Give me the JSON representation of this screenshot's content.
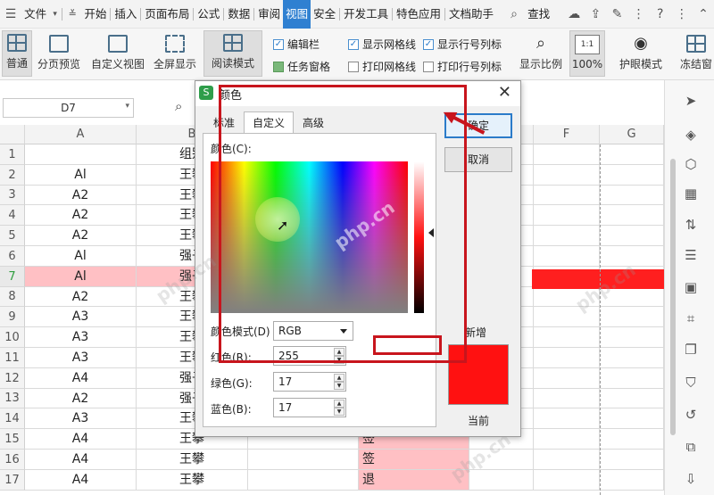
{
  "menubar": {
    "file": "文件",
    "items": [
      "开始",
      "插入",
      "页面布局",
      "公式",
      "数据",
      "审阅",
      "视图",
      "安全",
      "开发工具",
      "特色应用",
      "文档助手"
    ],
    "active_index": 6,
    "search": "查找"
  },
  "ribbon": {
    "normal": "普通",
    "page_break": "分页预览",
    "custom_view": "自定义视图",
    "fullscreen": "全屏显示",
    "reading_mode": "阅读模式",
    "edit_bar": "编辑栏",
    "task_pane": "任务窗格",
    "show_grid": "显示网格线",
    "print_grid": "打印网格线",
    "show_headers": "显示行号列标",
    "print_headers": "打印行号列标",
    "zoom_ratio": "显示比例",
    "zoom_100": "100%",
    "zoom_box": "1:1",
    "eye_mode": "护眼模式",
    "freeze": "冻结窗"
  },
  "formula": {
    "namebox": "D7"
  },
  "sheet": {
    "columns": [
      "A",
      "B",
      "F",
      "G"
    ],
    "rows": [
      {
        "n": "1",
        "a": "",
        "b": "组别",
        "d": ""
      },
      {
        "n": "2",
        "a": "Al",
        "b": "王攀",
        "d": ""
      },
      {
        "n": "3",
        "a": "A2",
        "b": "王攀",
        "d": ""
      },
      {
        "n": "4",
        "a": "A2",
        "b": "王攀",
        "d": ""
      },
      {
        "n": "5",
        "a": "A2",
        "b": "王攀",
        "d": ""
      },
      {
        "n": "6",
        "a": "Al",
        "b": "强子",
        "d": ""
      },
      {
        "n": "7",
        "a": "Al",
        "b": "强子",
        "d": ""
      },
      {
        "n": "8",
        "a": "A2",
        "b": "王攀",
        "d": ""
      },
      {
        "n": "9",
        "a": "A3",
        "b": "王攀",
        "d": ""
      },
      {
        "n": "10",
        "a": "A3",
        "b": "王攀",
        "d": ""
      },
      {
        "n": "11",
        "a": "A3",
        "b": "王攀",
        "d": ""
      },
      {
        "n": "12",
        "a": "A4",
        "b": "强子",
        "d": ""
      },
      {
        "n": "13",
        "a": "A2",
        "b": "强子",
        "d": ""
      },
      {
        "n": "14",
        "a": "A3",
        "b": "王攀",
        "d": ""
      },
      {
        "n": "15",
        "a": "A4",
        "b": "王攀",
        "d": "签"
      },
      {
        "n": "16",
        "a": "A4",
        "b": "王攀",
        "d": "签"
      },
      {
        "n": "17",
        "a": "A4",
        "b": "王攀",
        "d": "退"
      }
    ]
  },
  "dialog": {
    "title": "颜色",
    "tabs": [
      "标准",
      "自定义",
      "高级"
    ],
    "active_tab": 1,
    "color_label": "颜色(C):",
    "mode_label": "颜色模式(D)",
    "mode_value": "RGB",
    "red_label": "红色(R):",
    "red_value": "255",
    "green_label": "绿色(G):",
    "green_value": "17",
    "blue_label": "蓝色(B):",
    "blue_value": "17",
    "ok": "确定",
    "cancel": "取消",
    "new_label": "新增",
    "current_label": "当前",
    "new_color": "#FF1111"
  },
  "watermark": "php.cn"
}
